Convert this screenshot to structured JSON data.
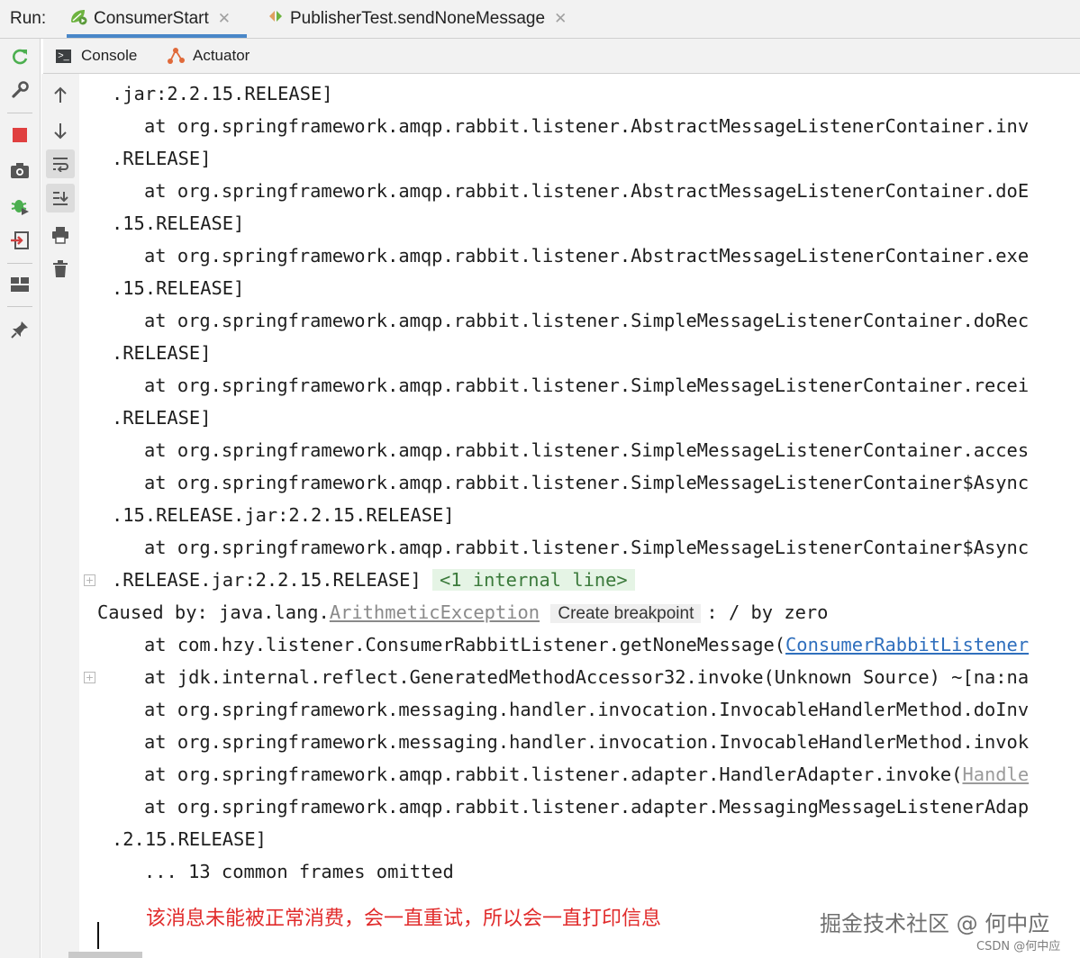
{
  "run_label": "Run:",
  "tabs": [
    {
      "label": "ConsumerStart",
      "icon": "spring-leaf-run-icon",
      "active": true
    },
    {
      "label": "PublisherTest.sendNoneMessage",
      "icon": "test-run-icon",
      "active": false
    }
  ],
  "subtabs": [
    {
      "label": "Console",
      "icon": "console-icon"
    },
    {
      "label": "Actuator",
      "icon": "actuator-icon"
    }
  ],
  "console": {
    "lines": [
      ".jar:2.2.15.RELEASE]",
      "at org.springframework.amqp.rabbit.listener.AbstractMessageListenerContainer.inv",
      ".RELEASE]",
      "at org.springframework.amqp.rabbit.listener.AbstractMessageListenerContainer.doE",
      ".15.RELEASE]",
      "at org.springframework.amqp.rabbit.listener.AbstractMessageListenerContainer.exe",
      ".15.RELEASE]",
      "at org.springframework.amqp.rabbit.listener.SimpleMessageListenerContainer.doRec",
      ".RELEASE]",
      "at org.springframework.amqp.rabbit.listener.SimpleMessageListenerContainer.recei",
      ".RELEASE]",
      "at org.springframework.amqp.rabbit.listener.SimpleMessageListenerContainer.acces",
      "at org.springframework.amqp.rabbit.listener.SimpleMessageListenerContainer$Async",
      ".15.RELEASE.jar:2.2.15.RELEASE]",
      "at org.springframework.amqp.rabbit.listener.SimpleMessageListenerContainer$Async"
    ],
    "folded_prefix": ".RELEASE.jar:2.2.15.RELEASE] ",
    "folded_badge": "<1 internal line>",
    "caused_prefix": "Caused by: java.lang.",
    "caused_exception": "ArithmeticException",
    "breakpoint_label": "Create breakpoint",
    "caused_suffix": ": / by zero",
    "trace_consumer_prefix": "at com.hzy.listener.ConsumerRabbitListener.getNoneMessage(",
    "trace_consumer_link": "ConsumerRabbitListener",
    "trace_lines2": [
      "at jdk.internal.reflect.GeneratedMethodAccessor32.invoke(Unknown Source) ~[na:na",
      "at org.springframework.messaging.handler.invocation.InvocableHandlerMethod.doInv",
      "at org.springframework.messaging.handler.invocation.InvocableHandlerMethod.invok"
    ],
    "trace_adapter_prefix": "at org.springframework.amqp.rabbit.listener.adapter.HandlerAdapter.invoke(",
    "trace_adapter_link": "Handle",
    "trace_messaging": "at org.springframework.amqp.rabbit.listener.adapter.MessagingMessageListenerAdap",
    "release_line": ".2.15.RELEASE]",
    "omitted": "... 13 common frames omitted"
  },
  "note": "该消息未能被正常消费，会一直重试，所以会一直打印信息",
  "watermark": "掘金技术社区 @ 何中应",
  "watermark_small": "CSDN @何中应",
  "colors": {
    "tab_underline": "#4a87c8",
    "note": "#e12b2b",
    "link": "#2f6fbd",
    "internal_bg": "#e5f4e5"
  }
}
